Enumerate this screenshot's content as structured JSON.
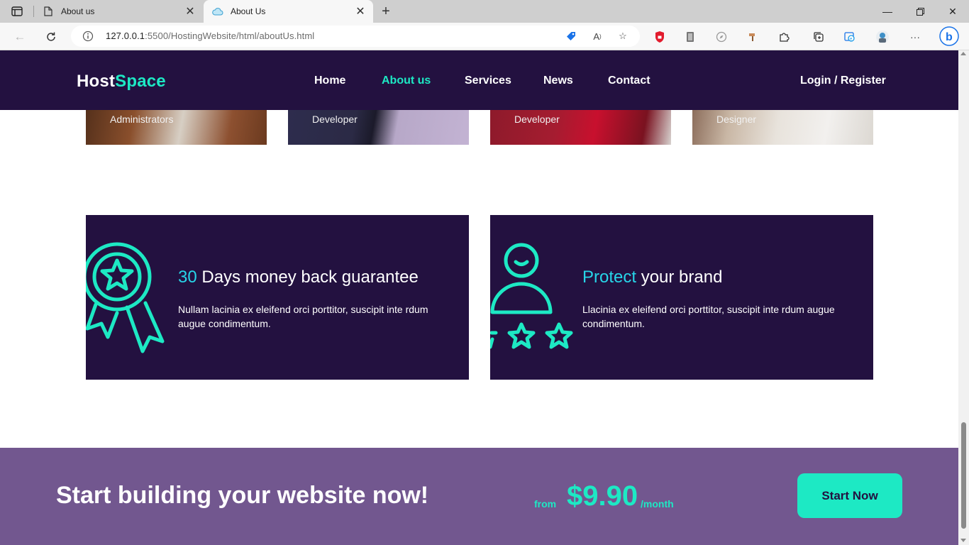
{
  "browser": {
    "tabs": [
      {
        "title": "About us",
        "icon": "page-icon",
        "active": false
      },
      {
        "title": "About Us",
        "icon": "cloud-icon",
        "active": true
      }
    ],
    "url": {
      "host": "127.0.0.1",
      "rest": ":5500/HostingWebsite/html/aboutUs.html"
    }
  },
  "header": {
    "logo": {
      "part1": "Host",
      "part2": "Space"
    },
    "nav": [
      {
        "label": "Home",
        "active": false
      },
      {
        "label": "About us",
        "active": true
      },
      {
        "label": "Services",
        "active": false
      },
      {
        "label": "News",
        "active": false
      },
      {
        "label": "Contact",
        "active": false
      }
    ],
    "login": "Login / Register"
  },
  "team": [
    {
      "role": "Administrators"
    },
    {
      "role": "Developer"
    },
    {
      "role": "Developer"
    },
    {
      "role": "Designer"
    }
  ],
  "features": [
    {
      "highlight": "30",
      "title_rest": " Days money back guarantee",
      "text": "Nullam lacinia ex eleifend orci porttitor, suscipit inte rdum augue condimentum.",
      "icon": "award-ribbon-icon"
    },
    {
      "highlight": "Protect",
      "title_rest": " your brand",
      "text": "Llacinia ex eleifend orci porttitor, suscipit inte rdum augue condimentum.",
      "icon": "user-rating-icon"
    }
  ],
  "cta": {
    "title": "Start building your website now!",
    "from": "from",
    "price": "$9.90",
    "per": "/month",
    "button": "Start Now"
  },
  "colors": {
    "brand_dark": "#231140",
    "accent": "#1de9c4",
    "highlight": "#27d5e8",
    "cta_bg": "#72578f"
  }
}
